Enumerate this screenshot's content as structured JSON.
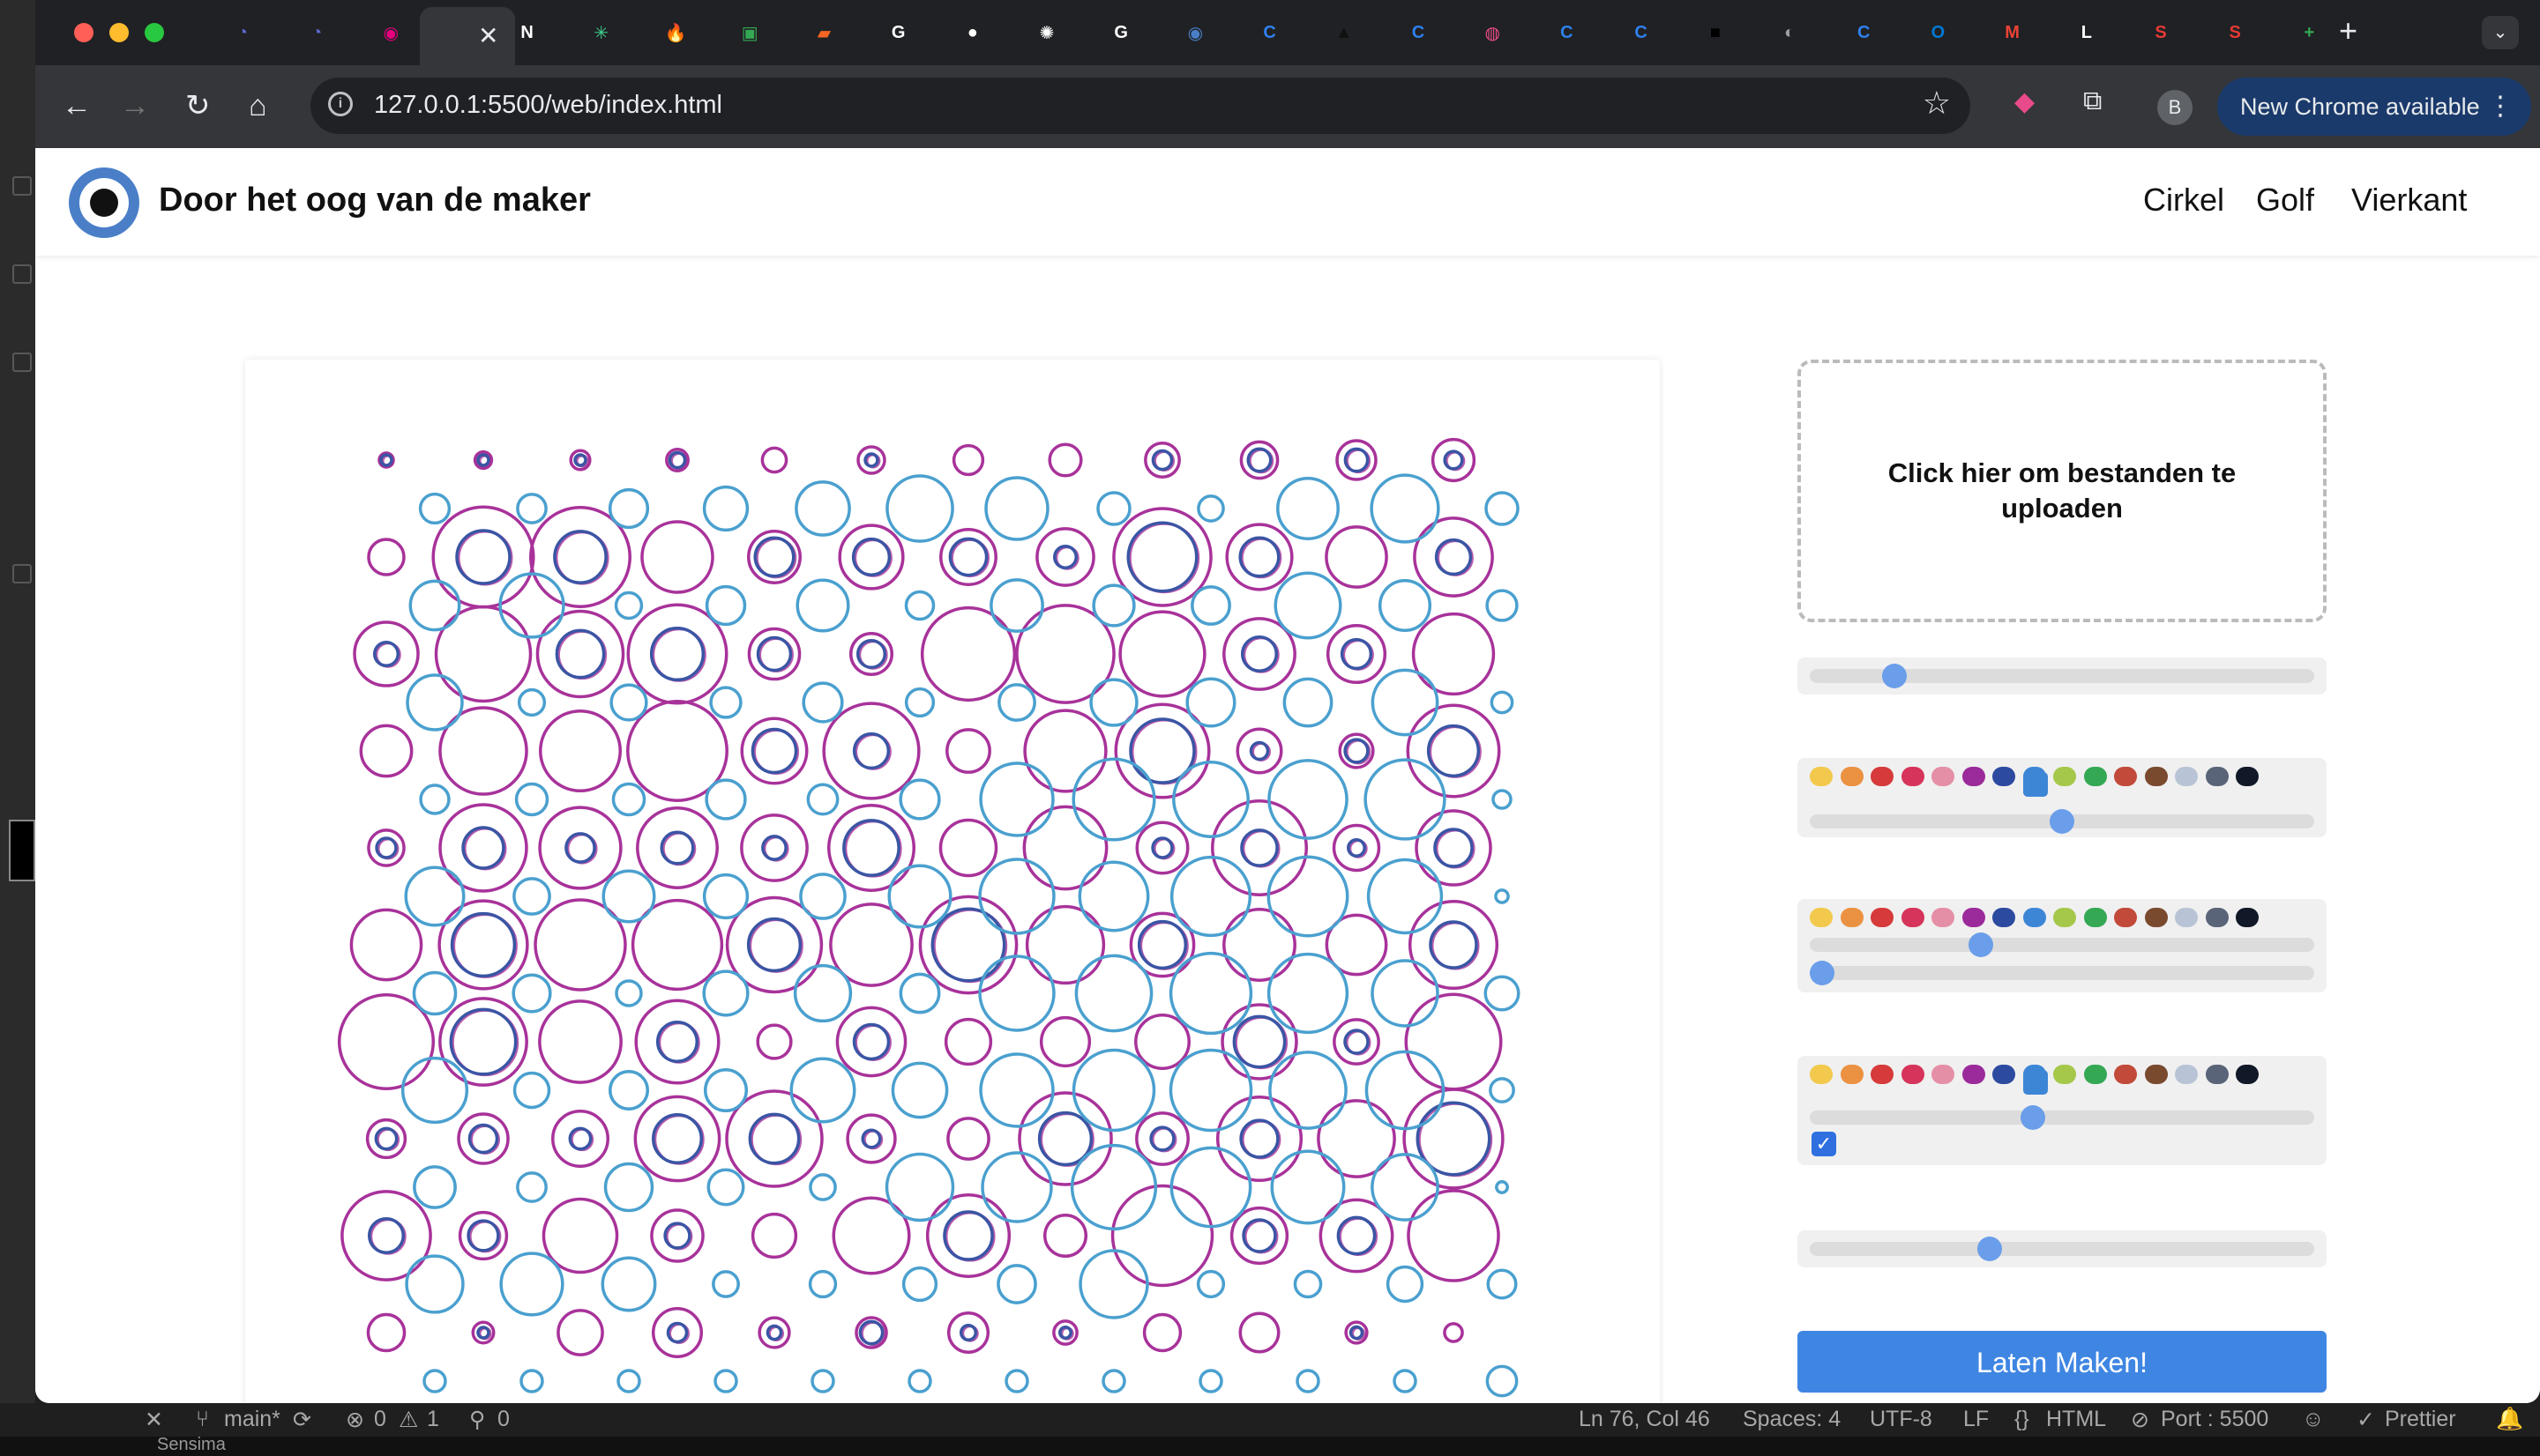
{
  "browser": {
    "tabs": [
      {
        "icon": "linear-icon",
        "color": "#5e6ad2",
        "glyph": "◔"
      },
      {
        "icon": "linear-icon",
        "color": "#5e6ad2",
        "glyph": "◔"
      },
      {
        "icon": "record-icon",
        "color": "#e6007e",
        "glyph": "◉"
      },
      {
        "icon": "notion-icon",
        "color": "#ffffff",
        "glyph": "N"
      },
      {
        "icon": "asterisk-icon",
        "color": "#3ecf8e",
        "glyph": "✳"
      },
      {
        "icon": "fire-icon",
        "color": "#f7931e",
        "glyph": "🔥"
      },
      {
        "icon": "sheet-icon",
        "color": "#34a853",
        "glyph": "▣"
      },
      {
        "icon": "bookmark-icon",
        "color": "#f26522",
        "glyph": "▰"
      },
      {
        "icon": "google-icon",
        "color": "#ffffff",
        "glyph": "G"
      },
      {
        "icon": "github-icon",
        "color": "#ffffff",
        "glyph": "●"
      },
      {
        "icon": "openai-icon",
        "color": "#ffffff",
        "glyph": "✺"
      },
      {
        "icon": "google-icon",
        "color": "#ffffff",
        "glyph": "G"
      },
      {
        "icon": "eye-icon",
        "color": "#4a7fc8",
        "glyph": "◉"
      },
      {
        "icon": "c-icon",
        "color": "#2f80ed",
        "glyph": "C"
      },
      {
        "icon": "triangle-icon",
        "color": "#111111",
        "glyph": "▲"
      },
      {
        "icon": "c-icon",
        "color": "#2f80ed",
        "glyph": "C"
      },
      {
        "icon": "dribbble-icon",
        "color": "#ea4c89",
        "glyph": "◍"
      },
      {
        "icon": "c-icon",
        "color": "#2f80ed",
        "glyph": "C"
      },
      {
        "icon": "c-icon",
        "color": "#2f80ed",
        "glyph": "C"
      },
      {
        "icon": "square-icon",
        "color": "#000000",
        "glyph": "■"
      },
      {
        "icon": "globe-icon",
        "color": "#9aa0a6",
        "glyph": "◐"
      },
      {
        "icon": "c-icon",
        "color": "#2f80ed",
        "glyph": "C"
      },
      {
        "icon": "outlook-icon",
        "color": "#0078d4",
        "glyph": "O"
      },
      {
        "icon": "gmail-icon",
        "color": "#ea4335",
        "glyph": "M"
      },
      {
        "icon": "l-icon",
        "color": "#ffffff",
        "glyph": "L"
      },
      {
        "icon": "s-icon",
        "color": "#e53935",
        "glyph": "S"
      },
      {
        "icon": "s-icon",
        "color": "#e53935",
        "glyph": "S"
      },
      {
        "icon": "plus-sheet-icon",
        "color": "#34a853",
        "glyph": "+"
      }
    ],
    "url": "127.0.0.1:5500/web/index.html",
    "profile_initial": "B",
    "update_label": "New Chrome available"
  },
  "site": {
    "title": "Door het oog van de maker",
    "nav": [
      "Cirkel",
      "Golf",
      "Vierkant"
    ]
  },
  "controls": {
    "upload_label": "Click hier om bestanden te uploaden",
    "slider1_value": 0.15,
    "palette_colors": [
      "#f2c94c",
      "#eb9142",
      "#d63a3a",
      "#d6345a",
      "#e58fa6",
      "#9b2a9a",
      "#2c4aa0",
      "#3d86d6",
      "#a5c84a",
      "#34a853",
      "#c24a3a",
      "#7a4a2e",
      "#b8c4d6",
      "#5a6478",
      "#111827"
    ],
    "palette1": {
      "handle_index": 7,
      "slider_value": 0.5
    },
    "palette2": {
      "slider_top_value": 0.33,
      "slider_bottom_value": 0.0
    },
    "palette3": {
      "handle_index": 7,
      "slider_value": 0.44,
      "checked": true
    },
    "slider5_value": 0.35,
    "make_button": "Laten Maken!"
  },
  "artwork": {
    "description": "Circle grid generated art",
    "palette": {
      "magenta": "#a8329a",
      "blue": "#3a55a4",
      "cyan": "#4aa0cf"
    }
  },
  "statusbar": {
    "branch": "main*",
    "errors": "0",
    "warnings": "1",
    "ports": "0",
    "position": "Ln 76, Col 46",
    "spaces": "Spaces: 4",
    "encoding": "UTF-8",
    "eol": "LF",
    "language": "HTML",
    "port": "Port : 5500",
    "prettier": "Prettier"
  },
  "taskbar_label": "Sensima"
}
